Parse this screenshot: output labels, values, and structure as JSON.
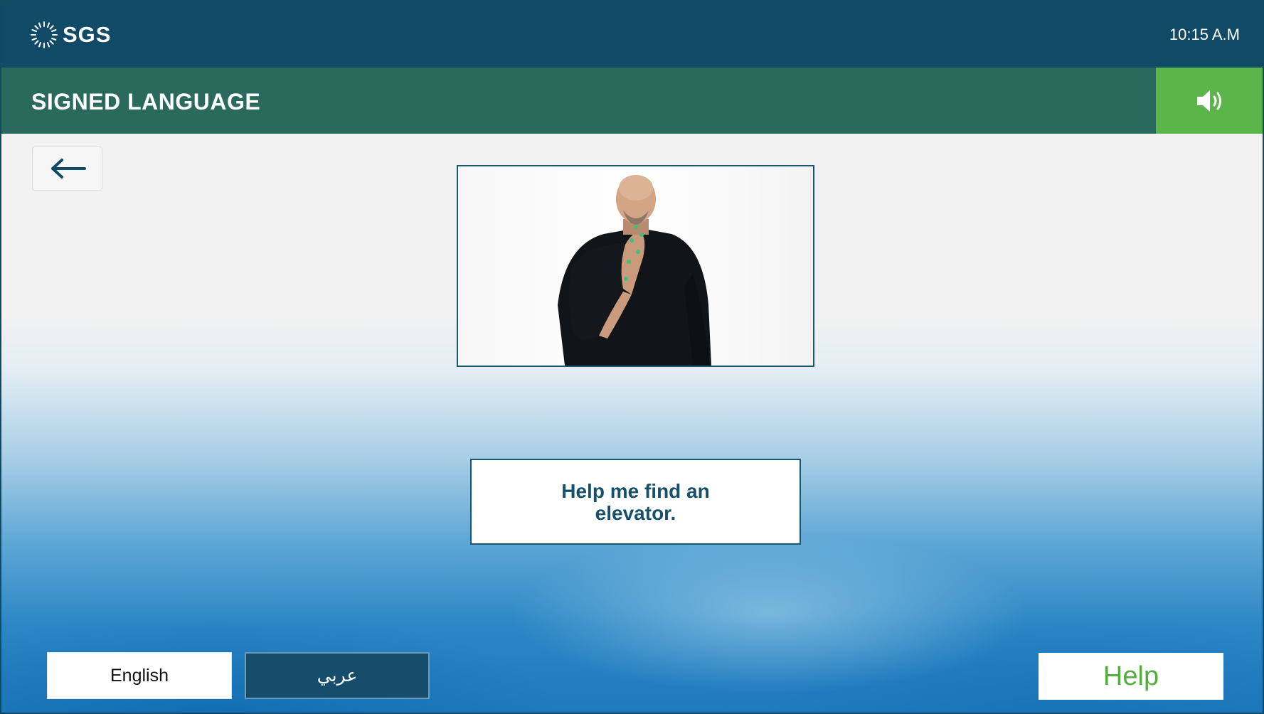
{
  "header": {
    "logo_text": "SGS",
    "time": "10:15 A.M"
  },
  "titlebar": {
    "title": "SIGNED LANGUAGE",
    "sound_icon": "speaker-volume-icon"
  },
  "navigation": {
    "back_icon": "arrow-left-icon"
  },
  "video": {
    "description_icon": "sign-language-video"
  },
  "phrase": {
    "text": "Help me find an elevator."
  },
  "footer": {
    "languages": [
      "English",
      "عربي"
    ],
    "active_language": "عربي",
    "help_label": "Help"
  },
  "colors": {
    "top_bar": "#114a66",
    "title_bar": "#2a6a5c",
    "accent_green": "#5bb548",
    "help_text": "#54ad3e",
    "phrase_text": "#17506b"
  }
}
